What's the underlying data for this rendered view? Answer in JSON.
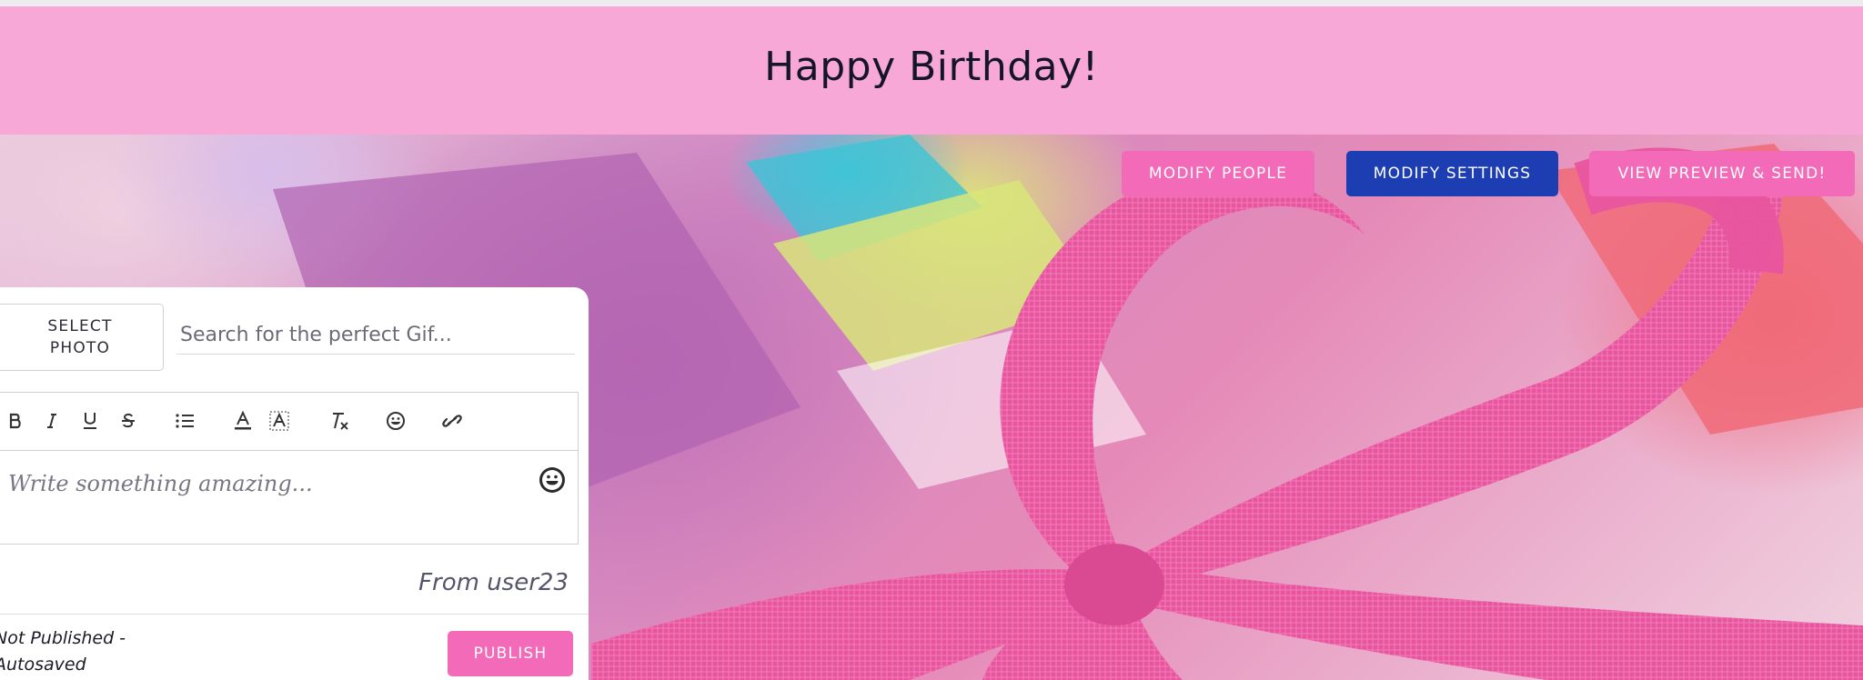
{
  "header": {
    "title": "Happy Birthday!"
  },
  "actions": {
    "modify_people": "MODIFY PEOPLE",
    "modify_settings": "MODIFY SETTINGS",
    "view_preview": "VIEW PREVIEW & SEND!"
  },
  "editor": {
    "select_photo": "SELECT\nPHOTO",
    "gif_search_placeholder": "Search for the perfect Gif...",
    "gif_search_value": "",
    "toolbar": [
      "bold-icon",
      "italic-icon",
      "underline-icon",
      "strikethrough-icon",
      "bullet-list-icon",
      "text-color-icon",
      "highlight-color-icon",
      "clear-format-icon",
      "emoji-icon",
      "link-icon"
    ],
    "message_placeholder": "Write something amazing...",
    "from": "From user23",
    "status": "Not Published -\nAutosaved",
    "publish": "PUBLISH"
  },
  "colors": {
    "header_bg": "#f8a8d6",
    "pink_button": "#f26ab8",
    "blue_button": "#1d3db2"
  }
}
